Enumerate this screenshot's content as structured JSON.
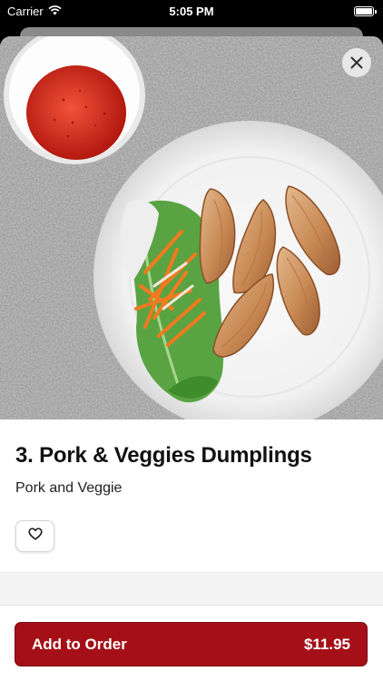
{
  "status_bar": {
    "carrier": "Carrier",
    "time": "5:05 PM"
  },
  "item": {
    "title": "3. Pork & Veggies Dumplings",
    "description": "Pork and Veggie"
  },
  "order_button": {
    "label": "Add to Order",
    "price": "$11.95"
  },
  "colors": {
    "accent": "#a51018"
  }
}
